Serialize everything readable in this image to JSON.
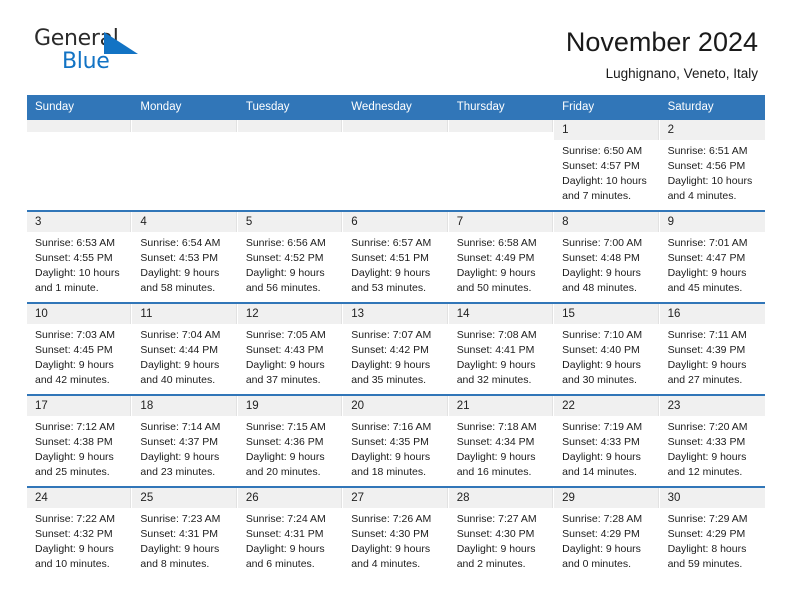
{
  "brand": {
    "word_one": "General",
    "word_two": "Blue",
    "flag_color": "#1273c4",
    "text_color": "#2b2b2b"
  },
  "header": {
    "title": "November 2024",
    "subtitle": "Lughignano, Veneto, Italy",
    "accent_color": "#3176b8"
  },
  "weekdays": [
    "Sunday",
    "Monday",
    "Tuesday",
    "Wednesday",
    "Thursday",
    "Friday",
    "Saturday"
  ],
  "labels": {
    "sunrise_prefix": "Sunrise:",
    "sunset_prefix": "Sunset:",
    "daylight_prefix": "Daylight:"
  },
  "weeks": [
    [
      {
        "day": "",
        "sunrise": "",
        "sunset": "",
        "daylight_line1": "",
        "daylight_line2": ""
      },
      {
        "day": "",
        "sunrise": "",
        "sunset": "",
        "daylight_line1": "",
        "daylight_line2": ""
      },
      {
        "day": "",
        "sunrise": "",
        "sunset": "",
        "daylight_line1": "",
        "daylight_line2": ""
      },
      {
        "day": "",
        "sunrise": "",
        "sunset": "",
        "daylight_line1": "",
        "daylight_line2": ""
      },
      {
        "day": "",
        "sunrise": "",
        "sunset": "",
        "daylight_line1": "",
        "daylight_line2": ""
      },
      {
        "day": "1",
        "sunrise": "Sunrise: 6:50 AM",
        "sunset": "Sunset: 4:57 PM",
        "daylight_line1": "Daylight: 10 hours",
        "daylight_line2": "and 7 minutes."
      },
      {
        "day": "2",
        "sunrise": "Sunrise: 6:51 AM",
        "sunset": "Sunset: 4:56 PM",
        "daylight_line1": "Daylight: 10 hours",
        "daylight_line2": "and 4 minutes."
      }
    ],
    [
      {
        "day": "3",
        "sunrise": "Sunrise: 6:53 AM",
        "sunset": "Sunset: 4:55 PM",
        "daylight_line1": "Daylight: 10 hours",
        "daylight_line2": "and 1 minute."
      },
      {
        "day": "4",
        "sunrise": "Sunrise: 6:54 AM",
        "sunset": "Sunset: 4:53 PM",
        "daylight_line1": "Daylight: 9 hours",
        "daylight_line2": "and 58 minutes."
      },
      {
        "day": "5",
        "sunrise": "Sunrise: 6:56 AM",
        "sunset": "Sunset: 4:52 PM",
        "daylight_line1": "Daylight: 9 hours",
        "daylight_line2": "and 56 minutes."
      },
      {
        "day": "6",
        "sunrise": "Sunrise: 6:57 AM",
        "sunset": "Sunset: 4:51 PM",
        "daylight_line1": "Daylight: 9 hours",
        "daylight_line2": "and 53 minutes."
      },
      {
        "day": "7",
        "sunrise": "Sunrise: 6:58 AM",
        "sunset": "Sunset: 4:49 PM",
        "daylight_line1": "Daylight: 9 hours",
        "daylight_line2": "and 50 minutes."
      },
      {
        "day": "8",
        "sunrise": "Sunrise: 7:00 AM",
        "sunset": "Sunset: 4:48 PM",
        "daylight_line1": "Daylight: 9 hours",
        "daylight_line2": "and 48 minutes."
      },
      {
        "day": "9",
        "sunrise": "Sunrise: 7:01 AM",
        "sunset": "Sunset: 4:47 PM",
        "daylight_line1": "Daylight: 9 hours",
        "daylight_line2": "and 45 minutes."
      }
    ],
    [
      {
        "day": "10",
        "sunrise": "Sunrise: 7:03 AM",
        "sunset": "Sunset: 4:45 PM",
        "daylight_line1": "Daylight: 9 hours",
        "daylight_line2": "and 42 minutes."
      },
      {
        "day": "11",
        "sunrise": "Sunrise: 7:04 AM",
        "sunset": "Sunset: 4:44 PM",
        "daylight_line1": "Daylight: 9 hours",
        "daylight_line2": "and 40 minutes."
      },
      {
        "day": "12",
        "sunrise": "Sunrise: 7:05 AM",
        "sunset": "Sunset: 4:43 PM",
        "daylight_line1": "Daylight: 9 hours",
        "daylight_line2": "and 37 minutes."
      },
      {
        "day": "13",
        "sunrise": "Sunrise: 7:07 AM",
        "sunset": "Sunset: 4:42 PM",
        "daylight_line1": "Daylight: 9 hours",
        "daylight_line2": "and 35 minutes."
      },
      {
        "day": "14",
        "sunrise": "Sunrise: 7:08 AM",
        "sunset": "Sunset: 4:41 PM",
        "daylight_line1": "Daylight: 9 hours",
        "daylight_line2": "and 32 minutes."
      },
      {
        "day": "15",
        "sunrise": "Sunrise: 7:10 AM",
        "sunset": "Sunset: 4:40 PM",
        "daylight_line1": "Daylight: 9 hours",
        "daylight_line2": "and 30 minutes."
      },
      {
        "day": "16",
        "sunrise": "Sunrise: 7:11 AM",
        "sunset": "Sunset: 4:39 PM",
        "daylight_line1": "Daylight: 9 hours",
        "daylight_line2": "and 27 minutes."
      }
    ],
    [
      {
        "day": "17",
        "sunrise": "Sunrise: 7:12 AM",
        "sunset": "Sunset: 4:38 PM",
        "daylight_line1": "Daylight: 9 hours",
        "daylight_line2": "and 25 minutes."
      },
      {
        "day": "18",
        "sunrise": "Sunrise: 7:14 AM",
        "sunset": "Sunset: 4:37 PM",
        "daylight_line1": "Daylight: 9 hours",
        "daylight_line2": "and 23 minutes."
      },
      {
        "day": "19",
        "sunrise": "Sunrise: 7:15 AM",
        "sunset": "Sunset: 4:36 PM",
        "daylight_line1": "Daylight: 9 hours",
        "daylight_line2": "and 20 minutes."
      },
      {
        "day": "20",
        "sunrise": "Sunrise: 7:16 AM",
        "sunset": "Sunset: 4:35 PM",
        "daylight_line1": "Daylight: 9 hours",
        "daylight_line2": "and 18 minutes."
      },
      {
        "day": "21",
        "sunrise": "Sunrise: 7:18 AM",
        "sunset": "Sunset: 4:34 PM",
        "daylight_line1": "Daylight: 9 hours",
        "daylight_line2": "and 16 minutes."
      },
      {
        "day": "22",
        "sunrise": "Sunrise: 7:19 AM",
        "sunset": "Sunset: 4:33 PM",
        "daylight_line1": "Daylight: 9 hours",
        "daylight_line2": "and 14 minutes."
      },
      {
        "day": "23",
        "sunrise": "Sunrise: 7:20 AM",
        "sunset": "Sunset: 4:33 PM",
        "daylight_line1": "Daylight: 9 hours",
        "daylight_line2": "and 12 minutes."
      }
    ],
    [
      {
        "day": "24",
        "sunrise": "Sunrise: 7:22 AM",
        "sunset": "Sunset: 4:32 PM",
        "daylight_line1": "Daylight: 9 hours",
        "daylight_line2": "and 10 minutes."
      },
      {
        "day": "25",
        "sunrise": "Sunrise: 7:23 AM",
        "sunset": "Sunset: 4:31 PM",
        "daylight_line1": "Daylight: 9 hours",
        "daylight_line2": "and 8 minutes."
      },
      {
        "day": "26",
        "sunrise": "Sunrise: 7:24 AM",
        "sunset": "Sunset: 4:31 PM",
        "daylight_line1": "Daylight: 9 hours",
        "daylight_line2": "and 6 minutes."
      },
      {
        "day": "27",
        "sunrise": "Sunrise: 7:26 AM",
        "sunset": "Sunset: 4:30 PM",
        "daylight_line1": "Daylight: 9 hours",
        "daylight_line2": "and 4 minutes."
      },
      {
        "day": "28",
        "sunrise": "Sunrise: 7:27 AM",
        "sunset": "Sunset: 4:30 PM",
        "daylight_line1": "Daylight: 9 hours",
        "daylight_line2": "and 2 minutes."
      },
      {
        "day": "29",
        "sunrise": "Sunrise: 7:28 AM",
        "sunset": "Sunset: 4:29 PM",
        "daylight_line1": "Daylight: 9 hours",
        "daylight_line2": "and 0 minutes."
      },
      {
        "day": "30",
        "sunrise": "Sunrise: 7:29 AM",
        "sunset": "Sunset: 4:29 PM",
        "daylight_line1": "Daylight: 8 hours",
        "daylight_line2": "and 59 minutes."
      }
    ]
  ]
}
